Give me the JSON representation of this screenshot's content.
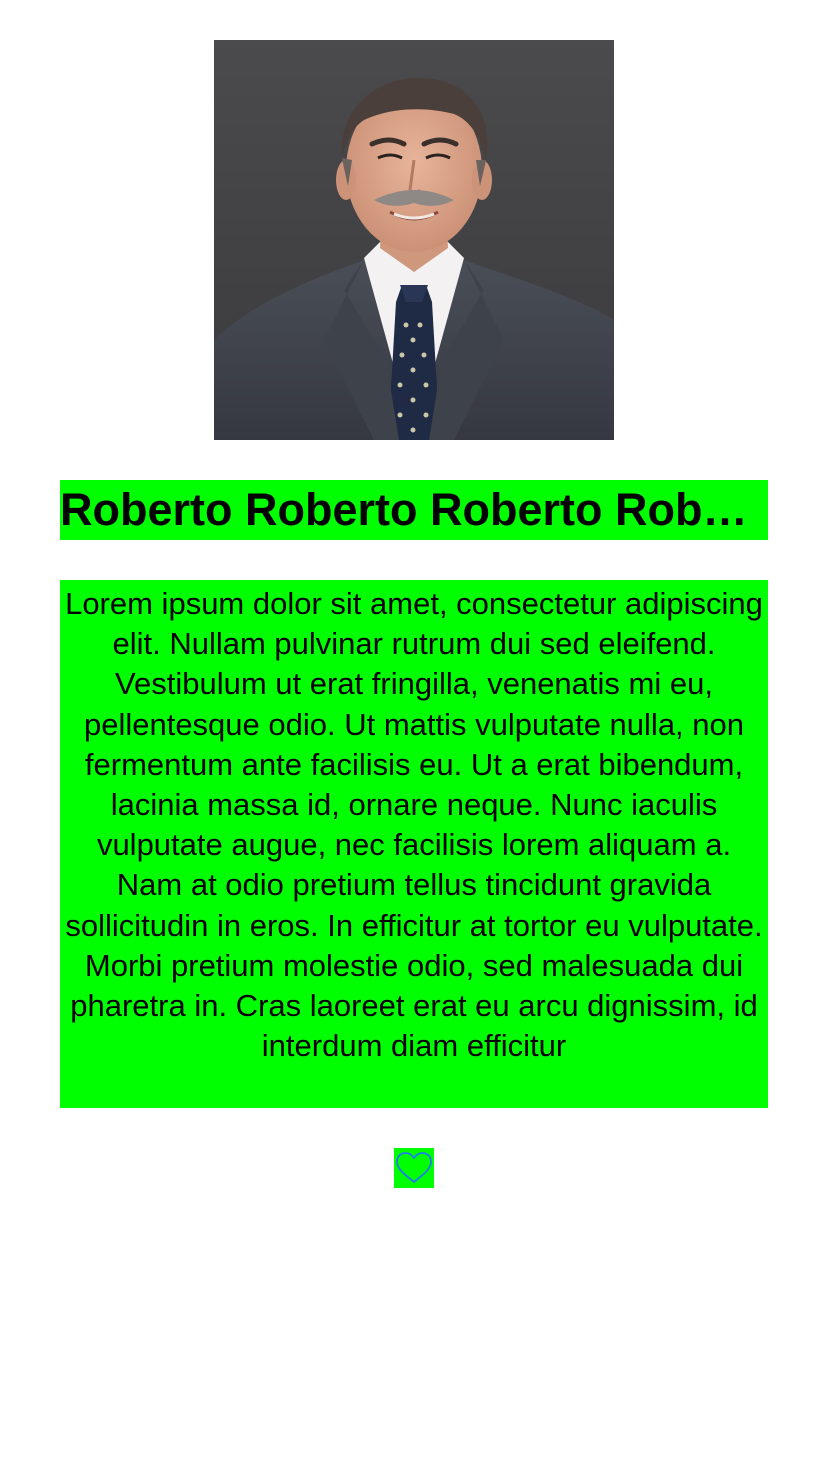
{
  "profile": {
    "name": "Roberto Roberto Roberto Roberto Roberto",
    "bio": "Lorem ipsum dolor sit amet, consectetur adipiscing elit. Nullam pulvinar rutrum dui sed eleifend. Vestibulum ut erat fringilla, venenatis mi eu, pellentesque odio. Ut mattis vulputate nulla, non fermentum ante facilisis eu. Ut a erat bibendum, lacinia massa id, ornare neque. Nunc iaculis vulputate augue, nec facilisis lorem aliquam a. Nam at odio pretium tellus tincidunt gravida sollicitudin in eros. In efficitur at tortor eu vulputate. Morbi pretium molestie odio, sed malesuada dui pharetra in. Cras laoreet erat eu arcu dignissim, id interdum diam efficitur",
    "photo_icon": "profile-photo",
    "like_icon": "heart-outline-icon"
  },
  "colors": {
    "highlight": "#00ff00",
    "heart": "#1e7cf0",
    "text": "#000000",
    "background": "#ffffff"
  }
}
